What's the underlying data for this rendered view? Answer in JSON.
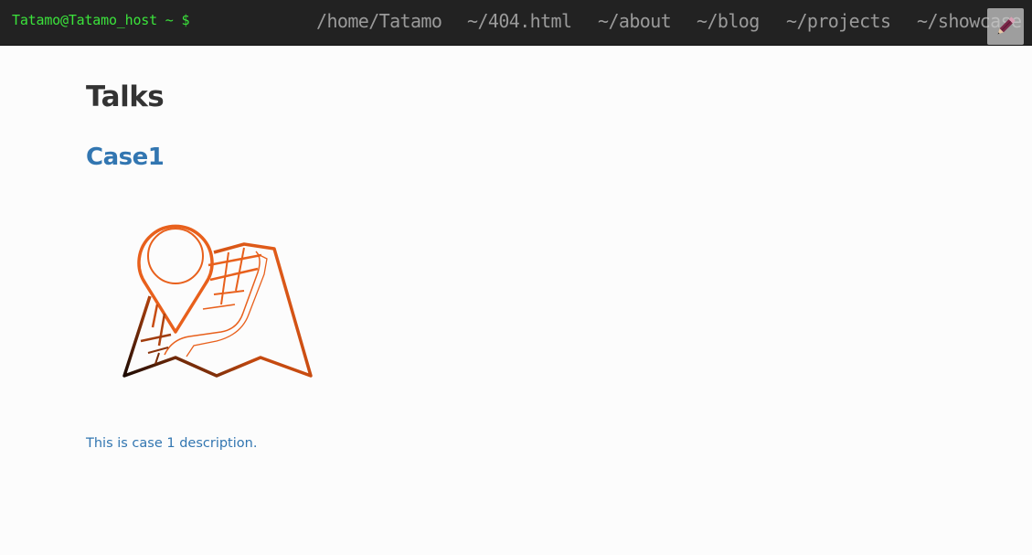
{
  "header": {
    "prompt": "Tatamo@Tatamo_host ~ $",
    "nav": [
      {
        "label": "/home/Tatamo"
      },
      {
        "label": "~/404.html"
      },
      {
        "label": "~/about"
      },
      {
        "label": "~/blog"
      },
      {
        "label": "~/projects"
      },
      {
        "label": "~/showcase"
      }
    ],
    "edit_icon": "pencil-icon"
  },
  "main": {
    "title": "Talks",
    "cases": [
      {
        "title": "Case1",
        "image_icon": "map-pin-icon",
        "description": "This is case 1 description."
      }
    ]
  },
  "colors": {
    "topbar_bg": "#222222",
    "prompt_green": "#3be23b",
    "nav_gray": "#9a9a9a",
    "link_blue": "#3276b1",
    "heading_dark": "#333333",
    "icon_orange": "#e8601c"
  }
}
